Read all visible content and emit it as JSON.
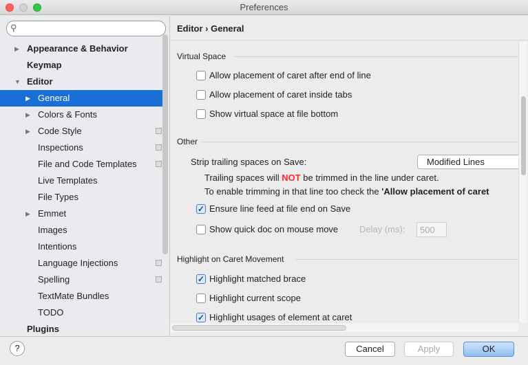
{
  "window": {
    "title": "Preferences"
  },
  "search": {
    "placeholder": ""
  },
  "sidebar": {
    "items": [
      {
        "label": "Appearance & Behavior",
        "level": 0,
        "arrow": "right",
        "bold": true
      },
      {
        "label": "Keymap",
        "level": 0,
        "bold": true
      },
      {
        "label": "Editor",
        "level": 0,
        "arrow": "down",
        "bold": true
      },
      {
        "label": "General",
        "level": 1,
        "arrow": "right",
        "selected": true
      },
      {
        "label": "Colors & Fonts",
        "level": 1,
        "arrow": "right"
      },
      {
        "label": "Code Style",
        "level": 1,
        "arrow": "right",
        "copy": true
      },
      {
        "label": "Inspections",
        "level": 1,
        "copy": true
      },
      {
        "label": "File and Code Templates",
        "level": 1,
        "copy": true
      },
      {
        "label": "Live Templates",
        "level": 1
      },
      {
        "label": "File Types",
        "level": 1
      },
      {
        "label": "Emmet",
        "level": 1,
        "arrow": "right"
      },
      {
        "label": "Images",
        "level": 1
      },
      {
        "label": "Intentions",
        "level": 1
      },
      {
        "label": "Language Injections",
        "level": 1,
        "copy": true
      },
      {
        "label": "Spelling",
        "level": 1,
        "copy": true
      },
      {
        "label": "TextMate Bundles",
        "level": 1
      },
      {
        "label": "TODO",
        "level": 1
      },
      {
        "label": "Plugins",
        "level": 0,
        "bold": true
      }
    ]
  },
  "main": {
    "breadcrumb": "Editor › General",
    "virtual_space": {
      "title": "Virtual Space",
      "options": [
        {
          "label": "Allow placement of caret after end of line",
          "checked": false
        },
        {
          "label": "Allow placement of caret inside tabs",
          "checked": false
        },
        {
          "label": "Show virtual space at file bottom",
          "checked": false
        }
      ]
    },
    "other": {
      "title": "Other",
      "strip_label": "Strip trailing spaces on Save:",
      "strip_value": "Modified Lines",
      "note_pre": "Trailing spaces will ",
      "note_not": "NOT",
      "note_post": " be trimmed in the line under caret.",
      "note2_pre": "To enable trimming in that line too check the ",
      "note2_bold": "'Allow placement of caret",
      "ensure_lf": {
        "label": "Ensure line feed at file end on Save",
        "checked": true
      },
      "quick_doc": {
        "label": "Show quick doc on mouse move",
        "checked": false
      },
      "delay_label": "Delay (ms):",
      "delay_value": "500"
    },
    "highlight": {
      "title": "Highlight on Caret Movement",
      "options": [
        {
          "label": "Highlight matched brace",
          "checked": true
        },
        {
          "label": "Highlight current scope",
          "checked": false
        },
        {
          "label": "Highlight usages of element at caret",
          "checked": true
        }
      ]
    }
  },
  "footer": {
    "help": "?",
    "cancel": "Cancel",
    "apply": "Apply",
    "ok": "OK"
  },
  "colors": {
    "selection": "#1a6fd6",
    "warning": "#ff2a2a",
    "ok_button": "#a9cdf5"
  }
}
